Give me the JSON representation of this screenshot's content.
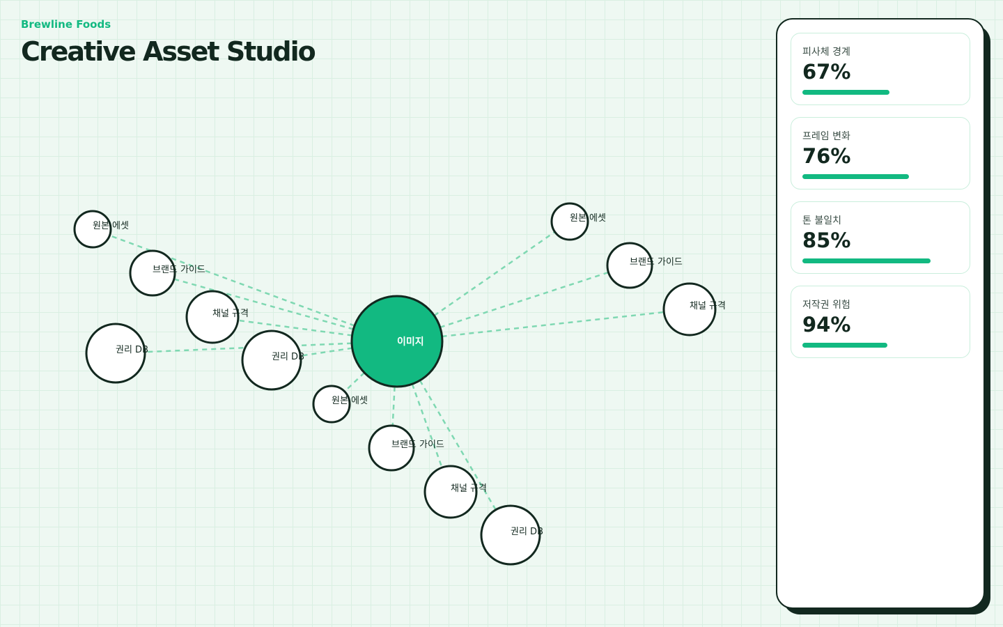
{
  "header": {
    "brand": "Brewline Foods",
    "title": "Creative Asset Studio"
  },
  "graph": {
    "hub": {
      "label": "이미지",
      "color": "#12b981"
    },
    "nodes": [
      {
        "label": "원본 에셋"
      },
      {
        "label": "브랜드 가이드"
      },
      {
        "label": "채널 규격"
      },
      {
        "label": "권리 DB"
      },
      {
        "label": "권리 DB"
      },
      {
        "label": "원본 에셋"
      },
      {
        "label": "브랜드 가이드"
      },
      {
        "label": "채널 규격"
      },
      {
        "label": "권리 DB"
      },
      {
        "label": "원본 에셋"
      },
      {
        "label": "브랜드 가이드"
      },
      {
        "label": "채널 규격"
      }
    ],
    "edge_color": "#7fd8b2"
  },
  "metrics": [
    {
      "label": "피사체 경계",
      "value": "67%",
      "level": 0.49
    },
    {
      "label": "프레임 변화",
      "value": "76%",
      "level": 0.6
    },
    {
      "label": "톤 불일치",
      "value": "85%",
      "level": 0.72
    },
    {
      "label": "저작권 위험",
      "value": "94%",
      "level": 0.48
    }
  ],
  "colors": {
    "accent": "#12b981",
    "ink": "#12281f"
  }
}
